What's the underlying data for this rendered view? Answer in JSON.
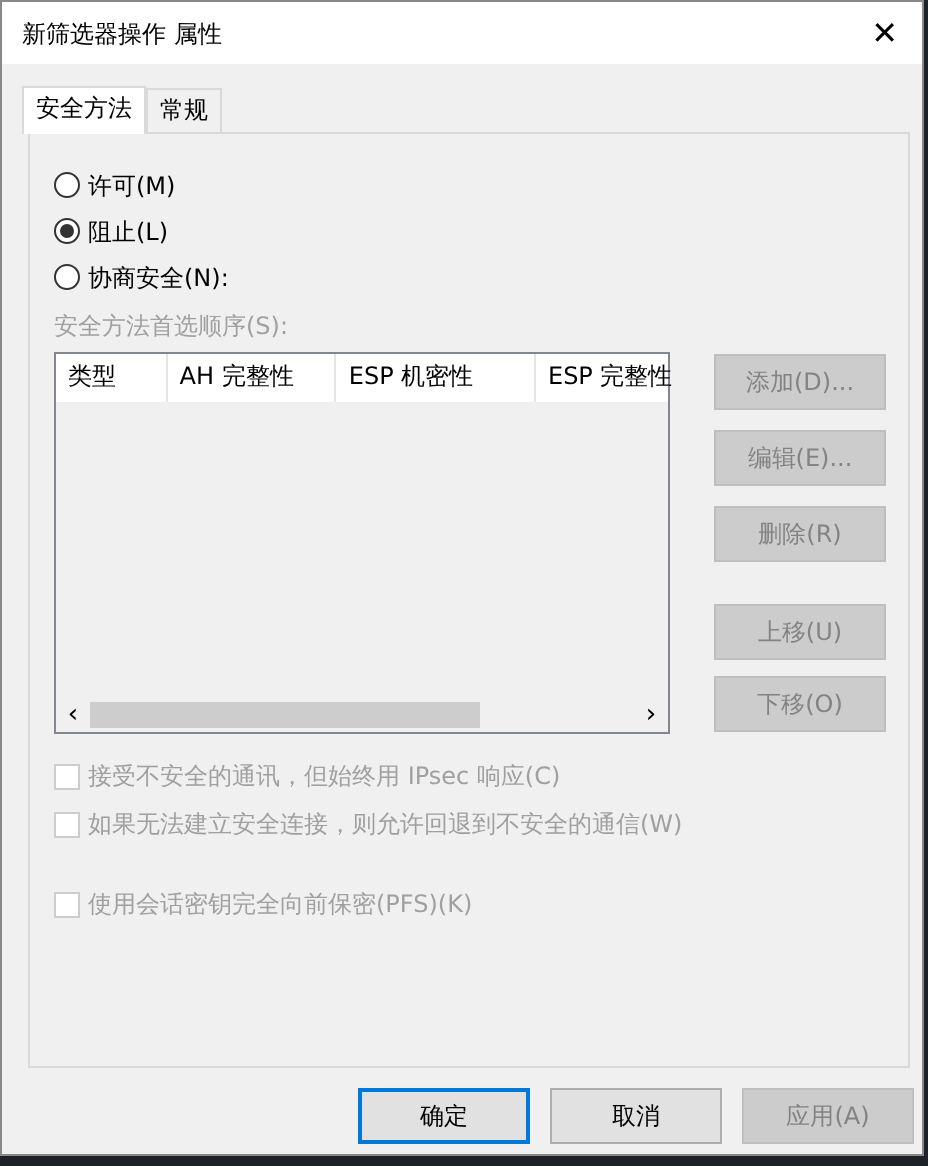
{
  "window": {
    "title": "新筛选器操作 属性",
    "close": "✕"
  },
  "tabs": [
    {
      "label": "安全方法",
      "selected": true
    },
    {
      "label": "常规",
      "selected": false
    }
  ],
  "actions": [
    {
      "label": "许可(M)",
      "selected": false
    },
    {
      "label": "阻止(L)",
      "selected": true
    },
    {
      "label": "协商安全(N):",
      "selected": false
    }
  ],
  "methods": {
    "label": "安全方法首选顺序(S):",
    "disabled": true,
    "columns": [
      "类型",
      "AH 完整性",
      "ESP 机密性",
      "ESP 完整性"
    ],
    "scroll_left": "‹",
    "scroll_right": "›"
  },
  "side_buttons": [
    {
      "label": "添加(D)...",
      "disabled": true
    },
    {
      "label": "编辑(E)...",
      "disabled": true
    },
    {
      "label": "删除(R)",
      "disabled": true
    },
    {
      "label": "上移(U)",
      "disabled": true
    },
    {
      "label": "下移(O)",
      "disabled": true
    }
  ],
  "options": [
    {
      "label": "接受不安全的通讯，但始终用 IPsec 响应(C)",
      "checked": false,
      "disabled": true
    },
    {
      "label": "如果无法建立安全连接，则允许回退到不安全的通信(W)",
      "checked": false,
      "disabled": true
    },
    {
      "label": "使用会话密钥完全向前保密(PFS)(K)",
      "checked": false,
      "disabled": true
    }
  ],
  "buttons": [
    {
      "label": "确定",
      "default": true,
      "disabled": false
    },
    {
      "label": "取消",
      "default": false,
      "disabled": false
    },
    {
      "label": "应用(A)",
      "default": false,
      "disabled": true
    }
  ]
}
